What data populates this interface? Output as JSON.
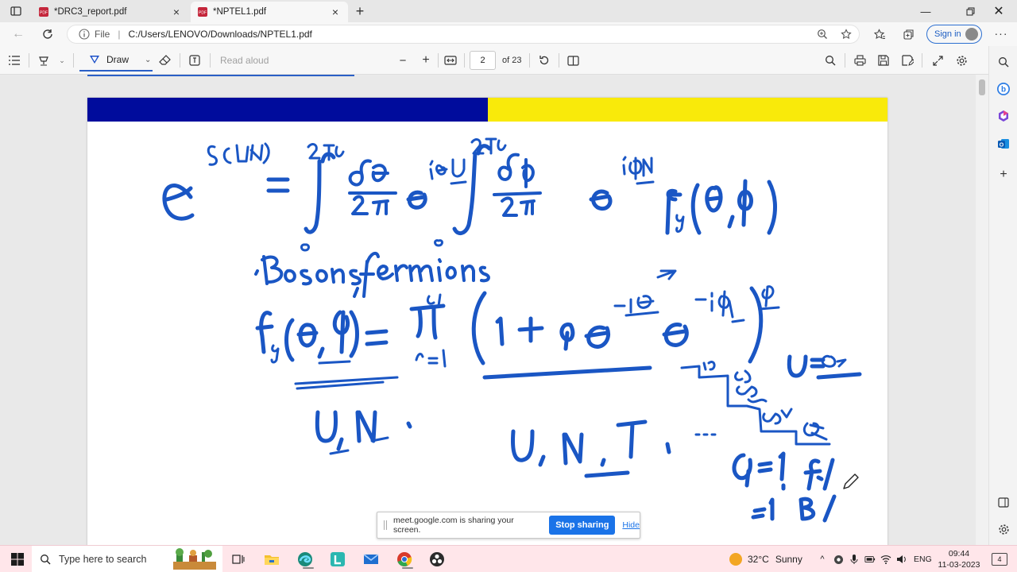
{
  "browser": {
    "tabs": [
      {
        "title": "*DRC3_report.pdf",
        "active": false
      },
      {
        "title": "*NPTEL1.pdf",
        "active": true
      }
    ],
    "address": {
      "scheme_label": "File",
      "url": "C:/Users/LENOVO/Downloads/NPTEL1.pdf"
    },
    "signin_label": "Sign in"
  },
  "pdf_toolbar": {
    "draw_label": "Draw",
    "read_aloud_label": "Read aloud",
    "page_current": "2",
    "page_total_label": "of 23"
  },
  "document": {
    "header_colors": {
      "left": "#000c9c",
      "right": "#f9ea0a"
    },
    "ink_color": "#1a56c4"
  },
  "share_banner": {
    "message": "meet.google.com is sharing your screen.",
    "stop_label": "Stop sharing",
    "hide_label": "Hide"
  },
  "taskbar": {
    "search_placeholder": "Type here to search",
    "weather": {
      "temp": "32°C",
      "condition": "Sunny"
    },
    "language": "ENG",
    "time": "09:44",
    "date": "11-03-2023",
    "notification_count": "4"
  }
}
